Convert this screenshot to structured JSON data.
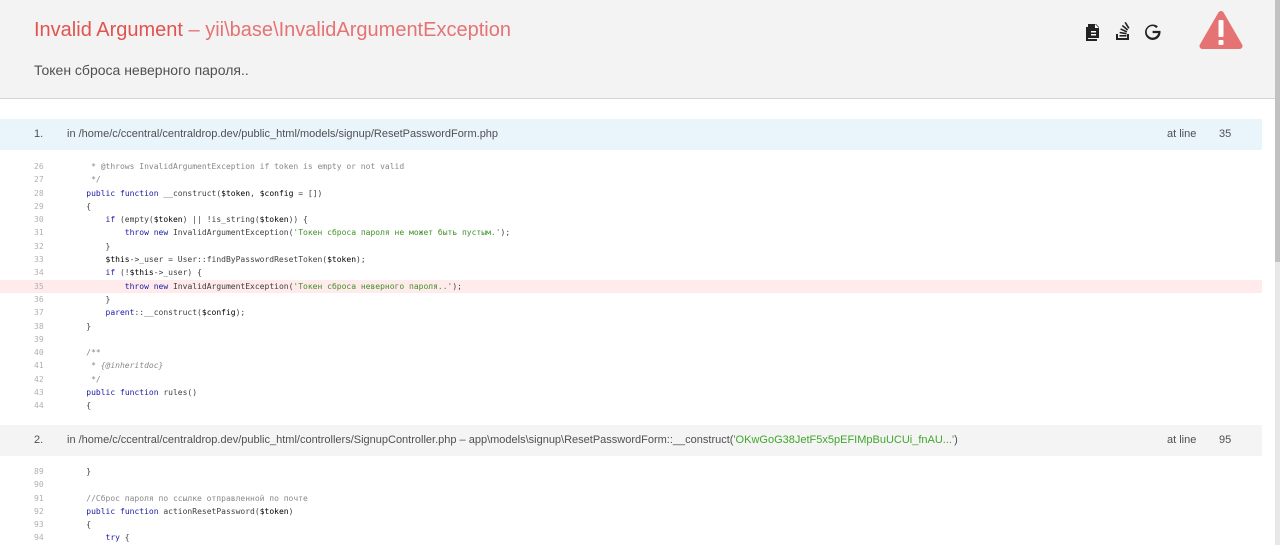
{
  "header": {
    "title": "Invalid Argument",
    "exception": "– yii\\base\\InvalidArgumentException",
    "message": "Токен сброса неверного пароля..",
    "tools": [
      {
        "icon": "copy-stacktrace-icon"
      },
      {
        "icon": "stackoverflow-icon"
      },
      {
        "icon": "google-search-icon"
      }
    ],
    "error_icon": "warning-triangle-icon",
    "colors": {
      "title": "#e0534f",
      "warning": "#e57373",
      "highlight": "#ffebeb",
      "call_bg": "#eaf4fb"
    }
  },
  "call_stack": [
    {
      "index": "1.",
      "path": "in /home/c/ccentral/centraldrop.dev/public_html/models/signup/ResetPasswordForm.php",
      "argument": "",
      "suffix": "",
      "at_line_label": "at line",
      "line": "35",
      "lines": [
        {
          "n": "26",
          "code": "     * @throws InvalidArgumentException if token is empty or not valid"
        },
        {
          "n": "27",
          "code": "     */"
        },
        {
          "n": "28",
          "code": "    public function __construct($token, $config = [])"
        },
        {
          "n": "29",
          "code": "    {"
        },
        {
          "n": "30",
          "code": "        if (empty($token) || !is_string($token)) {"
        },
        {
          "n": "31",
          "code": "            throw new InvalidArgumentException('Токен сброса пароля не может быть пустым.');"
        },
        {
          "n": "32",
          "code": "        }"
        },
        {
          "n": "33",
          "code": "        $this->_user = User::findByPasswordResetToken($token);"
        },
        {
          "n": "34",
          "code": "        if (!$this->_user) {"
        },
        {
          "n": "35",
          "code": "            throw new InvalidArgumentException('Токен сброса неверного пароля..');",
          "highlight": true
        },
        {
          "n": "36",
          "code": "        }"
        },
        {
          "n": "37",
          "code": "        parent::__construct($config);"
        },
        {
          "n": "38",
          "code": "    }"
        },
        {
          "n": "39",
          "code": ""
        },
        {
          "n": "40",
          "code": "    /**"
        },
        {
          "n": "41",
          "code": "     * {@inheritdoc}"
        },
        {
          "n": "42",
          "code": "     */"
        },
        {
          "n": "43",
          "code": "    public function rules()"
        },
        {
          "n": "44",
          "code": "    {"
        }
      ]
    },
    {
      "index": "2.",
      "path": "in /home/c/ccentral/centraldrop.dev/public_html/controllers/SignupController.php – app\\models\\signup\\ResetPasswordForm::__construct(",
      "argument": "'OKwGoG38JetF5x5pEFIMpBuUCUi_fnAU...'",
      "suffix": ")",
      "at_line_label": "at line",
      "line": "95",
      "lines": [
        {
          "n": "89",
          "code": "    }"
        },
        {
          "n": "90",
          "code": ""
        },
        {
          "n": "91",
          "code": "    //Сброс пароля по ссылке отправленной по почте"
        },
        {
          "n": "92",
          "code": "    public function actionResetPassword($token)"
        },
        {
          "n": "93",
          "code": "    {"
        },
        {
          "n": "94",
          "code": "        try {"
        }
      ]
    }
  ]
}
